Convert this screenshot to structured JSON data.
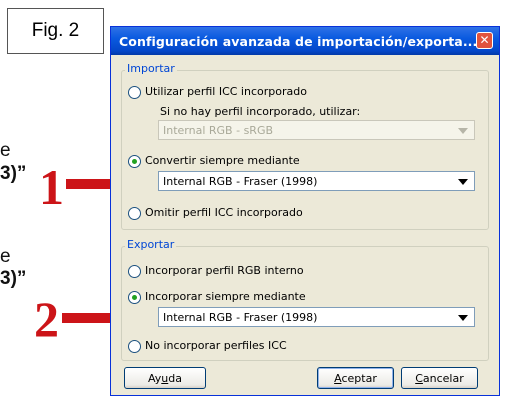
{
  "figure_label": "Fig. 2",
  "background_text": {
    "line1": "e",
    "line2": "3)”",
    "line3": "e",
    "line4": "3)”"
  },
  "annotations": {
    "marker1": "1",
    "marker2": "2",
    "color": "#cc1418"
  },
  "dialog": {
    "title": "Configuración avanzada de importación/exporta...",
    "close_glyph": "✕",
    "import_group": {
      "legend": "Importar",
      "option_embedded": "Utilizar perfil ICC incorporado",
      "fallback_label": "Si no hay perfil incorporado, utilizar:",
      "fallback_value": "Internal RGB - sRGB",
      "option_convert": "Convertir siempre mediante",
      "convert_value": "Internal RGB - Fraser (1998)",
      "option_omit": "Omitir perfil ICC incorporado",
      "selected": "option_convert"
    },
    "export_group": {
      "legend": "Exportar",
      "option_internal": "Incorporar perfil RGB interno",
      "option_always": "Incorporar siempre mediante",
      "always_value": "Internal RGB - Fraser (1998)",
      "option_none": "No incorporar perfiles ICC",
      "selected": "option_always"
    },
    "buttons": {
      "help_prefix": "Ay",
      "help_underlined": "u",
      "help_suffix": "da",
      "accept_underlined": "A",
      "accept_suffix": "ceptar",
      "cancel_underlined": "C",
      "cancel_suffix": "ancelar"
    }
  },
  "colors": {
    "titlebar": "#0a5ae0",
    "legend_text": "#0046d5",
    "dialog_bg": "#ece9d8",
    "radio_dot": "#21a121"
  }
}
